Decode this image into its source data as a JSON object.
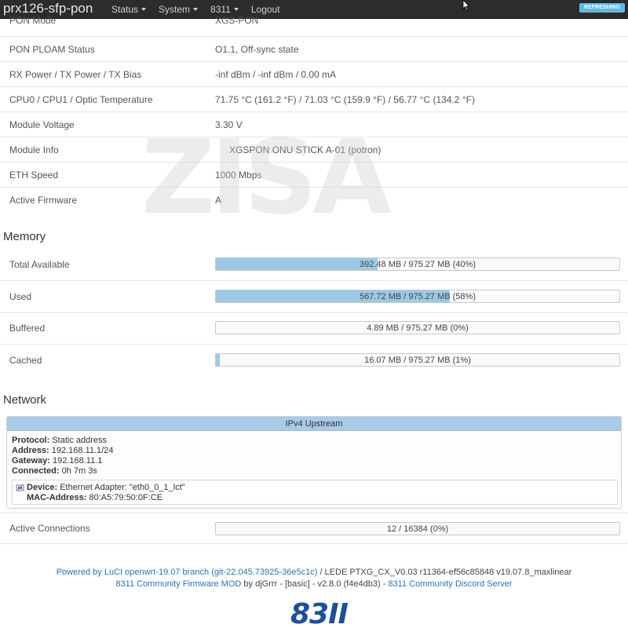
{
  "nav": {
    "brand": "prx126-sfp-pon",
    "menu": [
      {
        "label": "Status",
        "dropdown": true
      },
      {
        "label": "System",
        "dropdown": true
      },
      {
        "label": "8311",
        "dropdown": true
      },
      {
        "label": "Logout",
        "dropdown": false
      }
    ],
    "refresh_label": "REFRESHING"
  },
  "status_rows": [
    {
      "label": "PON Mode",
      "value": "XGS-PON"
    },
    {
      "label": "PON PLOAM Status",
      "value": "O1.1, Off-sync state"
    },
    {
      "label": "RX Power / TX Power / TX Bias",
      "value": "-inf dBm / -inf dBm / 0.00 mA"
    },
    {
      "label": "CPU0 / CPU1 / Optic Temperature",
      "value": "71.75 °C (161.2 °F) / 71.03 °C (159.9 °F) / 56.77 °C (134.2 °F)"
    },
    {
      "label": "Module Voltage",
      "value": "3.30 V"
    },
    {
      "label": "Module Info",
      "value": "XGSPON ONU STICK A-01 (potron)"
    },
    {
      "label": "ETH Speed",
      "value": "1000 Mbps"
    },
    {
      "label": "Active Firmware",
      "value": "A"
    }
  ],
  "memory": {
    "title": "Memory",
    "rows": [
      {
        "label": "Total Available",
        "text": "392.48 MB / 975.27 MB (40%)",
        "fraction": 0.4
      },
      {
        "label": "Used",
        "text": "567.72 MB / 975.27 MB (58%)",
        "fraction": 0.58
      },
      {
        "label": "Buffered",
        "text": "4.89 MB / 975.27 MB (0%)",
        "fraction": 0.0
      },
      {
        "label": "Cached",
        "text": "16.07 MB / 975.27 MB (1%)",
        "fraction": 0.01
      }
    ]
  },
  "network": {
    "title": "Network",
    "box_title": "IPv4 Upstream",
    "protocol_label": "Protocol:",
    "protocol": "Static address",
    "address_label": "Address:",
    "address": "192.168.11.1/24",
    "gateway_label": "Gateway:",
    "gateway": "192.168.11.1",
    "connected_label": "Connected:",
    "connected": "0h 7m 3s",
    "device_label": "Device:",
    "device": "Ethernet Adapter: \"eth0_0_1_lct\"",
    "mac_label": "MAC-Address:",
    "mac": "80:A5:79:50:0F:CE",
    "active_connections": {
      "label": "Active Connections",
      "text": "12 / 16384 (0%)",
      "fraction": 0.0
    }
  },
  "footer": {
    "line1_prefix": "Powered by ",
    "luci": "LuCI openwrt-19.07 branch",
    "git": " (git-22.045.73925-36e5c1c)",
    "line1_suffix": " / LEDE PTXG_CX_V0.03 r11364-ef56c85848 v19.07.8_maxlinear",
    "mod": "8311 Community Firmware MOD",
    "by": " by ",
    "author": "djGrrr",
    "version": " - [basic] - v2.8.0 (f4e4db3) - ",
    "discord": "8311 Community Discord Server",
    "logo": "83II"
  },
  "watermark": "ZISA"
}
